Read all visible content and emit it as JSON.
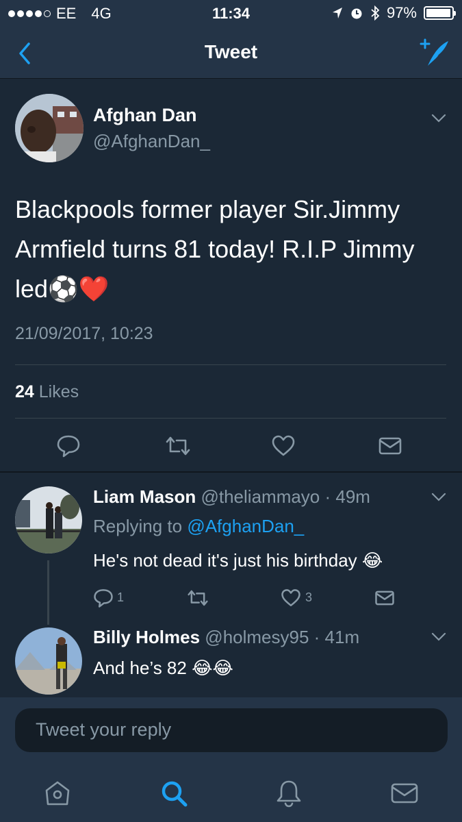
{
  "status_bar": {
    "carrier": "EE",
    "network": "4G",
    "time": "11:34",
    "battery": "97%",
    "battery_level": 0.97,
    "icons": [
      "location-arrow-icon",
      "alarm-icon",
      "bluetooth-icon",
      "battery-icon"
    ]
  },
  "nav": {
    "title": "Tweet",
    "back_icon": "chevron-left-icon",
    "compose_icon": "compose-tweet-icon"
  },
  "tweet": {
    "name": "Afghan Dan",
    "handle": "@AfghanDan_",
    "text": "Blackpools former player Sir.Jimmy Armfield turns 81 today! R.I.P Jimmy led⚽️❤️",
    "timestamp": "21/09/2017, 10:23",
    "likes_count": "24",
    "likes_label": "Likes",
    "actions": [
      "reply-icon",
      "retweet-icon",
      "like-icon",
      "message-icon"
    ]
  },
  "replies": [
    {
      "name": "Liam Mason",
      "handle": "@theliammayo",
      "time": "49m",
      "replying_prefix": "Replying to",
      "replying_to": "@AfghanDan_",
      "text": "He's not dead it's just his birthday 😂",
      "reply_count": "1",
      "like_count": "3"
    },
    {
      "name": "Billy Holmes",
      "handle": "@holmesy95",
      "time": "41m",
      "text": "And he’s 82 😂😂"
    }
  ],
  "composer": {
    "placeholder": "Tweet your reply"
  },
  "tab_bar": {
    "tabs": [
      "home-icon",
      "search-icon",
      "notifications-icon",
      "messages-icon"
    ],
    "active_tab": "search-icon"
  },
  "colors": {
    "background": "#1b2836",
    "bar": "#243447",
    "accent": "#1da1f2",
    "muted": "#8899a6",
    "divider": "#38444d"
  }
}
